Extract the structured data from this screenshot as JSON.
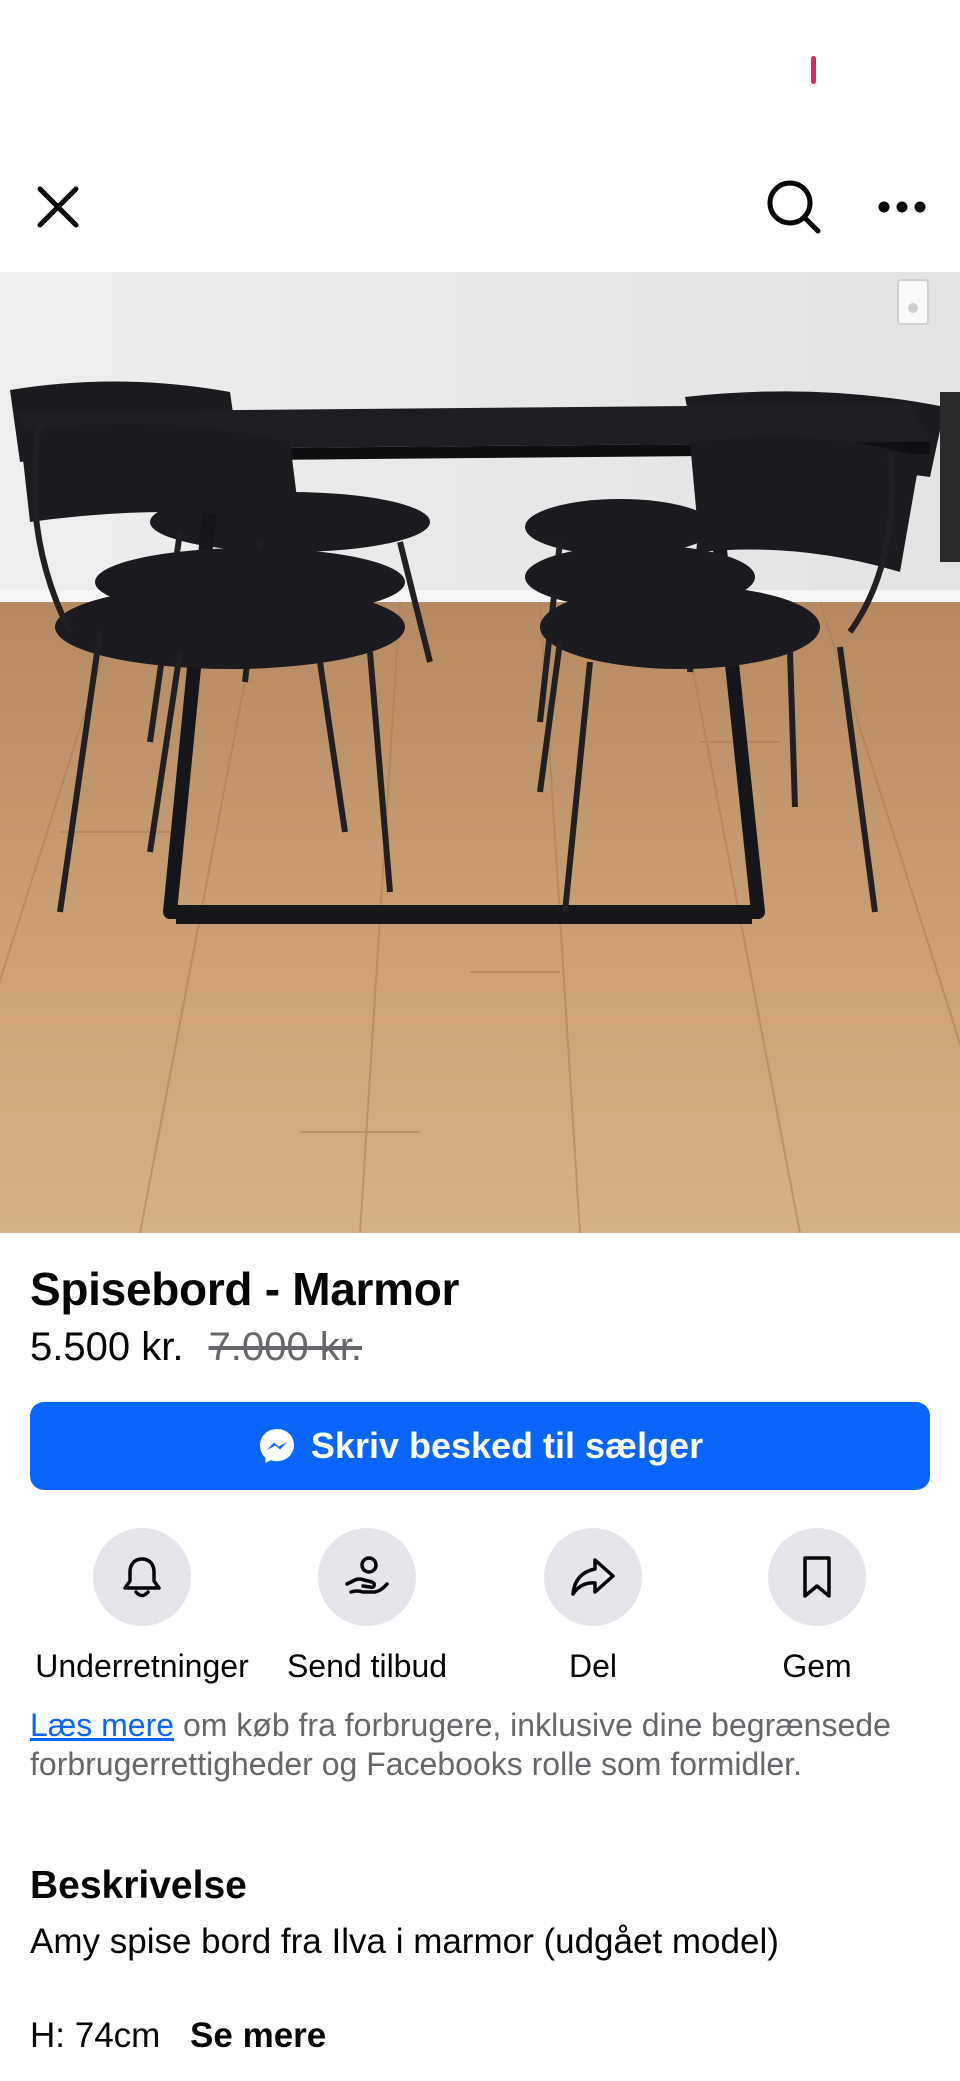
{
  "toolbar": {
    "close_icon": "close-icon",
    "search_icon": "search-icon",
    "more_icon": "more-horizontal-icon"
  },
  "photo": {
    "description_icon": "product-photo",
    "pager": {
      "count": 3,
      "active_index": 1
    }
  },
  "listing": {
    "title": "Spisebord - Marmor",
    "price": "5.500 kr.",
    "original_price": "7.000 kr."
  },
  "message_button": {
    "label": "Skriv besked til sælger",
    "icon": "messenger-icon",
    "color": "#0866ff"
  },
  "actions": [
    {
      "label": "Underretninger",
      "icon": "bell-icon"
    },
    {
      "label": "Send tilbud",
      "icon": "offer-hand-icon"
    },
    {
      "label": "Del",
      "icon": "share-arrow-icon"
    },
    {
      "label": "Gem",
      "icon": "bookmark-icon"
    }
  ],
  "consumer_info": {
    "link": "Læs mere",
    "text": " om køb fra forbrugere, inklusive dine begrænsede forbrugerrettigheder og Facebooks rolle som formidler."
  },
  "description": {
    "heading": "Beskrivelse",
    "line": "Amy spise bord fra Ilva i marmor (udgået model)",
    "dimension": "H: 74cm",
    "see_more": "Se mere"
  }
}
